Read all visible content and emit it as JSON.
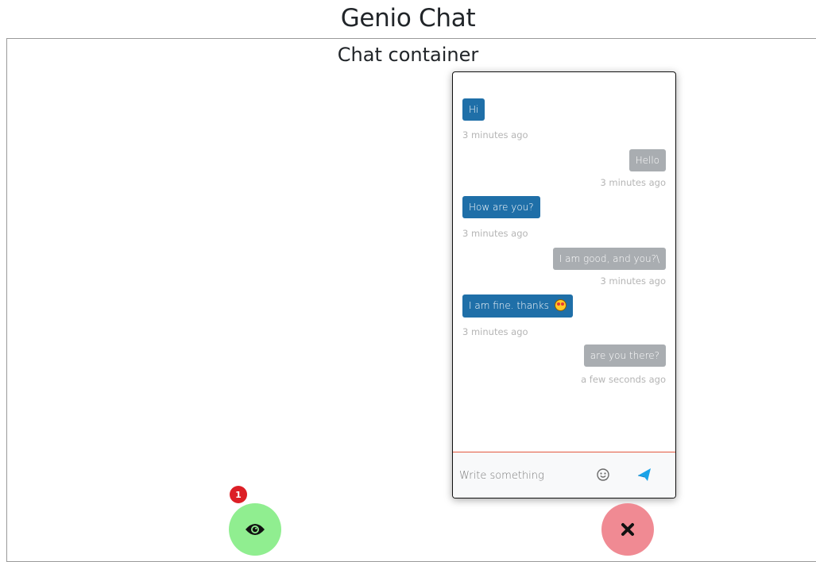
{
  "page": {
    "title": "Genio Chat",
    "container_title": "Chat container"
  },
  "chat": {
    "messages": [
      {
        "text": "Hi",
        "time": "3 minutes ago",
        "direction": "sent"
      },
      {
        "text": "Hello",
        "time": "3 minutes ago",
        "direction": "received"
      },
      {
        "text": "How are you?",
        "time": "3 minutes ago",
        "direction": "sent"
      },
      {
        "text": "I am good, and you?\\",
        "time": "3 minutes ago",
        "direction": "received"
      },
      {
        "text": "I am fine. thanks",
        "time": "3 minutes ago",
        "direction": "sent",
        "emoji": "star-struck-face-icon"
      },
      {
        "text": "are you there?",
        "time": "a few seconds ago",
        "direction": "received"
      }
    ],
    "input": {
      "placeholder": "Write something",
      "value": ""
    }
  },
  "launcher": {
    "unread_count": "1"
  },
  "icons": {
    "emoji_button": "smile-icon",
    "send_button": "paper-plane-icon",
    "open_button": "eye-icon",
    "close_button": "close-x-icon"
  },
  "colors": {
    "sent_bubble": "#1f6fa8",
    "received_bubble": "#a9adb1",
    "open_fab": "#90ee90",
    "close_fab": "#f08a93",
    "badge": "#dc1f26",
    "send_icon": "#1aa3e8"
  }
}
